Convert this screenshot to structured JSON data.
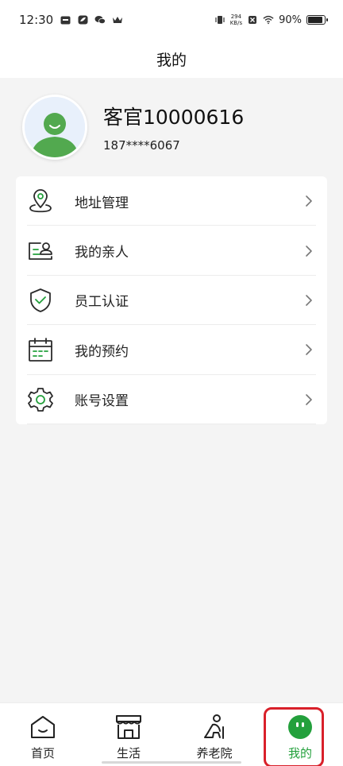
{
  "status_bar": {
    "time": "12:30",
    "net_speed_value": "294",
    "net_speed_unit": "KB/s",
    "battery": "90%",
    "battery_level": 0.9
  },
  "header": {
    "title": "我的"
  },
  "profile": {
    "name": "客官10000616",
    "phone": "187****6067"
  },
  "menu": {
    "items": [
      {
        "label": "地址管理",
        "icon": "location-pin-icon"
      },
      {
        "label": "我的亲人",
        "icon": "relatives-card-icon"
      },
      {
        "label": "员工认证",
        "icon": "shield-check-icon"
      },
      {
        "label": "我的预约",
        "icon": "calendar-icon"
      },
      {
        "label": "账号设置",
        "icon": "gear-icon"
      }
    ]
  },
  "tabs": [
    {
      "label": "首页",
      "icon": "home-icon",
      "active": false
    },
    {
      "label": "生活",
      "icon": "shop-icon",
      "active": false
    },
    {
      "label": "养老院",
      "icon": "elderly-icon",
      "active": false
    },
    {
      "label": "我的",
      "icon": "profile-face-icon",
      "active": true
    }
  ],
  "colors": {
    "accent": "#23a03c",
    "highlight_frame": "#d9202a",
    "background": "#f4f4f4"
  }
}
